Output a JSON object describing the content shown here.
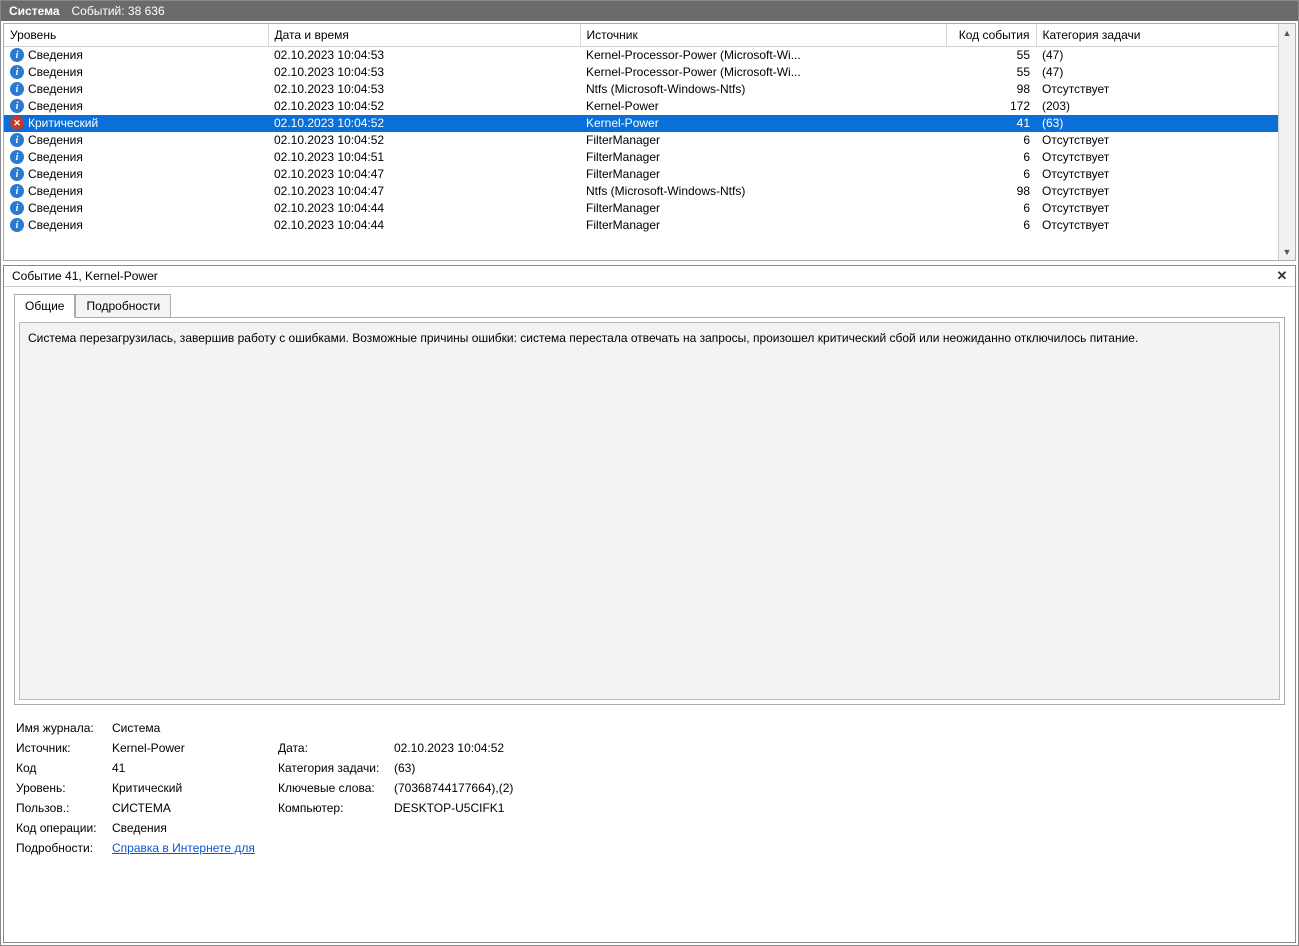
{
  "titlebar": {
    "title": "Система",
    "events_label": "Событий: 38 636"
  },
  "columns": {
    "level": "Уровень",
    "datetime": "Дата и время",
    "source": "Источник",
    "event_id": "Код события",
    "task_category": "Категория задачи"
  },
  "level_labels": {
    "info": "Сведения",
    "critical": "Критический"
  },
  "rows": [
    {
      "icon": "info",
      "datetime": "02.10.2023 10:04:53",
      "source": "Kernel-Processor-Power (Microsoft-Wi...",
      "id": "55",
      "task": "(47)"
    },
    {
      "icon": "info",
      "datetime": "02.10.2023 10:04:53",
      "source": "Kernel-Processor-Power (Microsoft-Wi...",
      "id": "55",
      "task": "(47)"
    },
    {
      "icon": "info",
      "datetime": "02.10.2023 10:04:53",
      "source": "Ntfs (Microsoft-Windows-Ntfs)",
      "id": "98",
      "task": "Отсутствует"
    },
    {
      "icon": "info",
      "datetime": "02.10.2023 10:04:52",
      "source": "Kernel-Power",
      "id": "172",
      "task": "(203)"
    },
    {
      "icon": "error",
      "datetime": "02.10.2023 10:04:52",
      "source": "Kernel-Power",
      "id": "41",
      "task": "(63)",
      "selected": true
    },
    {
      "icon": "info",
      "datetime": "02.10.2023 10:04:52",
      "source": "FilterManager",
      "id": "6",
      "task": "Отсутствует"
    },
    {
      "icon": "info",
      "datetime": "02.10.2023 10:04:51",
      "source": "FilterManager",
      "id": "6",
      "task": "Отсутствует"
    },
    {
      "icon": "info",
      "datetime": "02.10.2023 10:04:47",
      "source": "FilterManager",
      "id": "6",
      "task": "Отсутствует"
    },
    {
      "icon": "info",
      "datetime": "02.10.2023 10:04:47",
      "source": "Ntfs (Microsoft-Windows-Ntfs)",
      "id": "98",
      "task": "Отсутствует"
    },
    {
      "icon": "info",
      "datetime": "02.10.2023 10:04:44",
      "source": "FilterManager",
      "id": "6",
      "task": "Отсутствует"
    },
    {
      "icon": "info",
      "datetime": "02.10.2023 10:04:44",
      "source": "FilterManager",
      "id": "6",
      "task": "Отсутствует"
    }
  ],
  "detail": {
    "header": "Событие 41, Kernel-Power",
    "tabs": {
      "general": "Общие",
      "details": "Подробности"
    },
    "description": "Система перезагрузилась, завершив работу с ошибками. Возможные причины ошибки: система перестала отвечать на запросы, произошел критический сбой или неожиданно отключилось питание.",
    "labels": {
      "log_name": "Имя журнала:",
      "source": "Источник:",
      "event_id": "Код",
      "level": "Уровень:",
      "user": "Пользов.:",
      "opcode": "Код операции:",
      "more_info": "Подробности:",
      "date": "Дата:",
      "task_category": "Категория задачи:",
      "keywords": "Ключевые слова:",
      "computer": "Компьютер:"
    },
    "values": {
      "log_name": "Система",
      "source": "Kernel-Power",
      "event_id": "41",
      "level": "Критический",
      "user": "СИСТЕМА",
      "opcode": "Сведения",
      "help_link": "Справка в Интернете для ",
      "date": "02.10.2023 10:04:52",
      "task_category": "(63)",
      "keywords": "(70368744177664),(2)",
      "computer": "DESKTOP-U5CIFK1"
    }
  }
}
